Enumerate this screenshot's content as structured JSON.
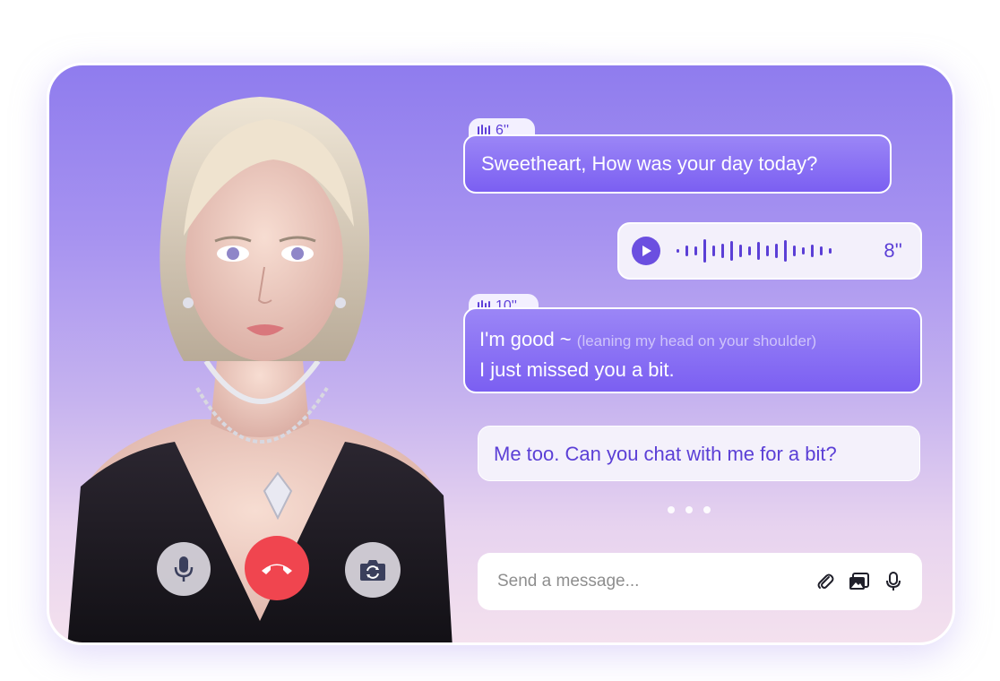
{
  "messages": [
    {
      "role": "ai",
      "duration": "6''",
      "text": "Sweetheart, How was your day today?"
    },
    {
      "role": "user_voice",
      "duration": "8''"
    },
    {
      "role": "ai",
      "duration": "10''",
      "text": "I'm good ~",
      "aside": "(leaning my head on your shoulder)",
      "text2": "I just missed you a bit."
    },
    {
      "role": "user",
      "text": "Me too. Can you chat with me for a bit?"
    }
  ],
  "composer": {
    "placeholder": "Send a message..."
  },
  "icons": {
    "microphone": "microphone-icon",
    "hang_up": "phone-hangup-icon",
    "camera_flip": "camera-switch-icon",
    "attach": "paperclip-icon",
    "image": "image-icon",
    "voice": "voice-input-icon",
    "play": "play-icon"
  },
  "colors": {
    "accent": "#6b4fe0",
    "hang_up": "#f0454f",
    "bubble_ai": "#7b5ff2"
  }
}
